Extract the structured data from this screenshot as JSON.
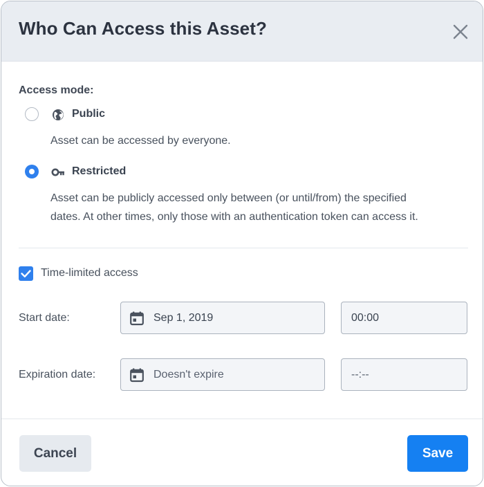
{
  "dialog": {
    "title": "Who Can Access this Asset?",
    "close_icon": "close-icon"
  },
  "access_mode": {
    "label": "Access mode:",
    "options": [
      {
        "label": "Public",
        "icon": "globe-icon",
        "description": "Asset can be accessed by everyone.",
        "selected": false
      },
      {
        "label": "Restricted",
        "icon": "key-icon",
        "description_line1": "Asset can be publicly accessed only between (or until/from) the specified",
        "description_line2": "dates. At other times, only those with an authentication token can access it.",
        "selected": true
      }
    ]
  },
  "time_limited": {
    "label": "Time-limited access",
    "checked": true
  },
  "start": {
    "label": "Start date:",
    "date_value": "Sep 1, 2019",
    "time_value": "00:00"
  },
  "expiration": {
    "label": "Expiration date:",
    "date_placeholder": "Doesn't expire",
    "time_placeholder": "--:--"
  },
  "footer": {
    "cancel_label": "Cancel",
    "save_label": "Save"
  },
  "colors": {
    "accent": "#2f80ed",
    "primary_button": "#1580f2",
    "header_bg": "#e9edf2"
  }
}
